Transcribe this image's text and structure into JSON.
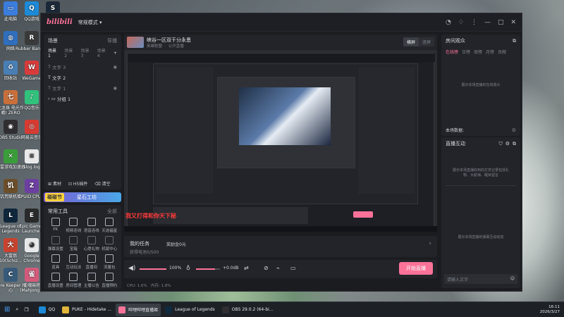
{
  "desktop_icons": [
    {
      "label": "此电脑",
      "color": "#3b7ddd",
      "glyph": "▭"
    },
    {
      "label": "QQ游戏",
      "color": "#1c8ad6",
      "glyph": "Q"
    },
    {
      "label": "Steam",
      "color": "#1b2838",
      "glyph": "S"
    },
    {
      "label": "网络",
      "color": "#2f6fbd",
      "glyph": "◍"
    },
    {
      "label": "Rubber Bandits",
      "color": "#3a3a3a",
      "glyph": "R"
    },
    {
      "label": "回收站",
      "color": "#4a7fb5",
      "glyph": "♻"
    },
    {
      "label": "WeGame",
      "color": "#d83b3b",
      "glyph": "W"
    },
    {
      "label": "七龙珠 电光作戦! ZERO",
      "color": "#c9703a",
      "glyph": "七"
    },
    {
      "label": "QQ音乐",
      "color": "#31c27c",
      "glyph": "♪"
    },
    {
      "label": "OBS Studio",
      "color": "#302e31",
      "glyph": "◉"
    },
    {
      "label": "网易云音乐",
      "color": "#d63b32",
      "glyph": "◎"
    },
    {
      "label": "迅雷游戏加速器",
      "color": "#3a9d3a",
      "glyph": "✕"
    },
    {
      "label": "slog.log",
      "color": "#e9e9e9",
      "glyph": "≡"
    },
    {
      "label": "饥荒联机版",
      "color": "#6b4e2a",
      "glyph": "饥"
    },
    {
      "label": "CPUID CPU-Z",
      "color": "#6d3fa1",
      "glyph": "Z"
    },
    {
      "label": "League of Legends",
      "color": "#10263a",
      "glyph": "L"
    },
    {
      "label": "Epic Games Launcher",
      "color": "#2a2a2a",
      "glyph": "E"
    },
    {
      "label": "大富翁10(Schiz...",
      "color": "#c8432f",
      "glyph": "大"
    },
    {
      "label": "Google Chrome",
      "color": "#e8e8e8",
      "glyph": "◕"
    },
    {
      "label": "Core Keeper 核心",
      "color": "#385a7a",
      "glyph": "C"
    },
    {
      "label": "雀魂麻将 (Mahjong...",
      "color": "#d45b7c",
      "glyph": "雀"
    }
  ],
  "window": {
    "logo": "bilibili",
    "mode_label": "常规模式 ▾",
    "title_icons": [
      "user-icon",
      "bell-icon",
      "more-icon",
      "minimize-icon",
      "maximize-icon",
      "close-icon"
    ]
  },
  "scene_panel": {
    "title": "场景",
    "import_label": "导播",
    "tabs": [
      "场景1",
      "场景2",
      "场景3",
      "场景4"
    ],
    "items": [
      "文字 3",
      "文字 2",
      "文字 1",
      "分组 1"
    ],
    "footer": [
      "素材",
      "H5插件",
      "清空"
    ]
  },
  "stream_info": {
    "title": "峡谷一区双干分永恩",
    "category": "英雄联盟",
    "visibility": "公开直播",
    "orientation": [
      "横屏",
      "竖屏"
    ]
  },
  "banner": {
    "left": "碰碰节",
    "right": "星石工坊"
  },
  "tools": {
    "title": "常用工具",
    "all_label": "全部",
    "items": [
      "PK",
      "视频连线",
      "语音连线",
      "天选福星",
      "弹幕设置",
      "宝箱",
      "心愿礼物",
      "机尾中心",
      "道具",
      "互动玩法",
      "直播间",
      "流量包",
      "直播设置",
      "房间管理",
      "主播公告",
      "直播预约"
    ]
  },
  "tasks": {
    "title": "我的任务",
    "reward": "奖励金0元",
    "desc": "获得电池0/500",
    "arrow": "›"
  },
  "audio": {
    "speaker_vol": "100%",
    "mic_vol": "+0.0dB"
  },
  "start_button": "开始直播",
  "status": {
    "cpu": "CPU: 1.6%",
    "mem": "内存: 1.8%"
  },
  "room_panel": {
    "title": "房间观众",
    "tabs": [
      "在线榜",
      "日榜",
      "周榜",
      "月榜",
      "贡献"
    ],
    "empty": "展示本场直播的在线观众",
    "footer": "本场数据:"
  },
  "interact_panel": {
    "title": "直播互动",
    "line1": "展示本场直播收到的打赏记录包括礼",
    "line2": "物、大航海、醒目留言",
    "line3": "展示本场直播的弹幕互动动态",
    "input_placeholder": "请输入文字"
  },
  "preview": {
    "overlay_text": "我又打得和你天下秘"
  },
  "taskbar": {
    "items": [
      {
        "label": "QQ",
        "color": "#1c8ad6"
      },
      {
        "label": "PUKE - Hidetake ...",
        "color": "#e0b53a"
      },
      {
        "label": "哔哩哔哩直播姬",
        "color": "#fb7299"
      },
      {
        "label": "League of Legends",
        "color": "#0f2a3f"
      },
      {
        "label": "OBS 29.0.2 (64-bi...",
        "color": "#302e31"
      }
    ],
    "time": "16:11",
    "date": "2026/3/27"
  }
}
